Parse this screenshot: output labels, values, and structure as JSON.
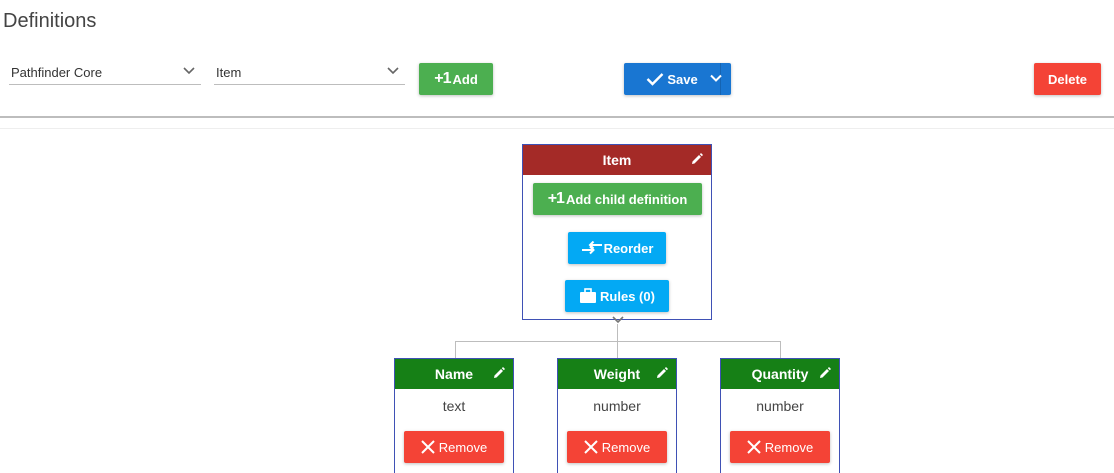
{
  "page": {
    "title": "Definitions"
  },
  "toolbar": {
    "system_select_value": "Pathfinder Core",
    "definition_select_value": "Item",
    "add_prefix": "+1",
    "add_label": "Add",
    "save_label": "Save",
    "delete_label": "Delete"
  },
  "root_node": {
    "title": "Item",
    "add_child_prefix": "+1",
    "add_child_label": "Add child definition",
    "reorder_label": "Reorder",
    "rules_label": "Rules (0)"
  },
  "children": [
    {
      "title": "Name",
      "type": "text",
      "remove_label": "Remove"
    },
    {
      "title": "Weight",
      "type": "number",
      "remove_label": "Remove"
    },
    {
      "title": "Quantity",
      "type": "number",
      "remove_label": "Remove"
    }
  ],
  "colors": {
    "root_header": "#a42a27",
    "child_header": "#168016",
    "node_border": "#3f51b5",
    "add": "#4caf50",
    "save": "#1976d2",
    "delete": "#f44336",
    "secondary": "#03a9f4"
  }
}
